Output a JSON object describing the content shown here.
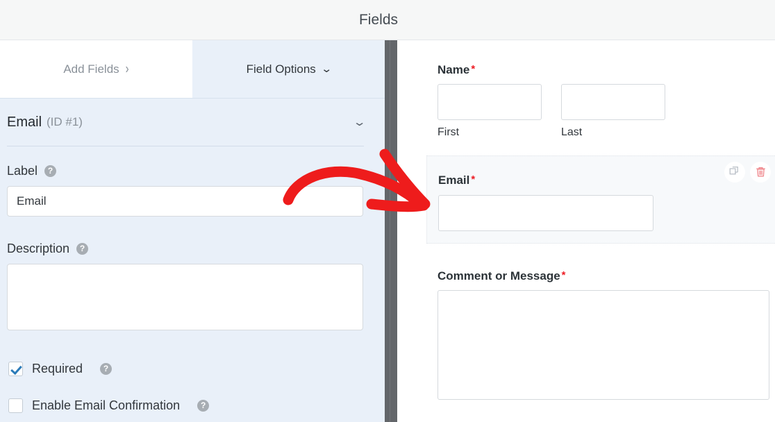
{
  "header": {
    "title": "Fields"
  },
  "left_panel": {
    "tabs": [
      {
        "label": "Add Fields",
        "icon": "chevron-right-icon",
        "chevron": "›",
        "active": false
      },
      {
        "label": "Field Options",
        "icon": "chevron-down-icon",
        "chevron": "⌄",
        "active": true
      }
    ],
    "field_header": {
      "title": "Email",
      "id_text": "(ID #1)",
      "collapse_icon": "chevron-down-icon",
      "collapse_glyph": "⌄"
    },
    "options": {
      "label": {
        "label": "Label",
        "help_icon": "help-circle-icon",
        "help_glyph": "?",
        "value": "Email",
        "placeholder": ""
      },
      "description": {
        "label": "Description",
        "help_icon": "help-circle-icon",
        "help_glyph": "?",
        "value": "",
        "placeholder": ""
      },
      "required": {
        "label": "Required",
        "checked": true,
        "help_icon": "help-circle-icon",
        "help_glyph": "?"
      },
      "email_confirmation": {
        "label": "Enable Email Confirmation",
        "checked": false,
        "help_icon": "help-circle-icon",
        "help_glyph": "?"
      }
    }
  },
  "preview_panel": {
    "fields": [
      {
        "label": "Name",
        "required_marker": "*",
        "sublabel_first": "First",
        "sublabel_last": "Last"
      },
      {
        "label": "Email",
        "required_marker": "*",
        "actions": [
          {
            "name": "duplicate-field-button",
            "icon": "duplicate-icon"
          },
          {
            "name": "delete-field-button",
            "icon": "trash-icon"
          }
        ]
      },
      {
        "label": "Comment or Message",
        "required_marker": "*"
      }
    ]
  },
  "annotation": {
    "type": "curved-arrow",
    "color": "#ee1c1c",
    "direction": "right"
  },
  "colors": {
    "panel_background": "#e9f0f9",
    "header_background": "#f6f7f7",
    "divider": "#63666a",
    "accent_required": "#ed1c24",
    "checkbox_check": "#2b7bb9",
    "delete_icon": "#f08a8f",
    "annotation_red": "#ee1c1c"
  }
}
